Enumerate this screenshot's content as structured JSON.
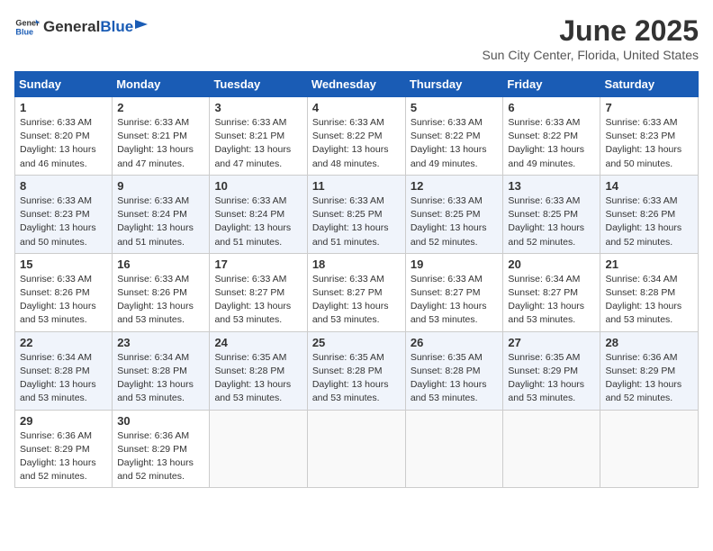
{
  "logo": {
    "general": "General",
    "blue": "Blue"
  },
  "title": "June 2025",
  "location": "Sun City Center, Florida, United States",
  "days": [
    "Sunday",
    "Monday",
    "Tuesday",
    "Wednesday",
    "Thursday",
    "Friday",
    "Saturday"
  ],
  "weeks": [
    [
      {
        "day": "1",
        "sunrise": "6:33 AM",
        "sunset": "8:20 PM",
        "daylight": "13 hours and 46 minutes."
      },
      {
        "day": "2",
        "sunrise": "6:33 AM",
        "sunset": "8:21 PM",
        "daylight": "13 hours and 47 minutes."
      },
      {
        "day": "3",
        "sunrise": "6:33 AM",
        "sunset": "8:21 PM",
        "daylight": "13 hours and 47 minutes."
      },
      {
        "day": "4",
        "sunrise": "6:33 AM",
        "sunset": "8:22 PM",
        "daylight": "13 hours and 48 minutes."
      },
      {
        "day": "5",
        "sunrise": "6:33 AM",
        "sunset": "8:22 PM",
        "daylight": "13 hours and 49 minutes."
      },
      {
        "day": "6",
        "sunrise": "6:33 AM",
        "sunset": "8:22 PM",
        "daylight": "13 hours and 49 minutes."
      },
      {
        "day": "7",
        "sunrise": "6:33 AM",
        "sunset": "8:23 PM",
        "daylight": "13 hours and 50 minutes."
      }
    ],
    [
      {
        "day": "8",
        "sunrise": "6:33 AM",
        "sunset": "8:23 PM",
        "daylight": "13 hours and 50 minutes."
      },
      {
        "day": "9",
        "sunrise": "6:33 AM",
        "sunset": "8:24 PM",
        "daylight": "13 hours and 51 minutes."
      },
      {
        "day": "10",
        "sunrise": "6:33 AM",
        "sunset": "8:24 PM",
        "daylight": "13 hours and 51 minutes."
      },
      {
        "day": "11",
        "sunrise": "6:33 AM",
        "sunset": "8:25 PM",
        "daylight": "13 hours and 51 minutes."
      },
      {
        "day": "12",
        "sunrise": "6:33 AM",
        "sunset": "8:25 PM",
        "daylight": "13 hours and 52 minutes."
      },
      {
        "day": "13",
        "sunrise": "6:33 AM",
        "sunset": "8:25 PM",
        "daylight": "13 hours and 52 minutes."
      },
      {
        "day": "14",
        "sunrise": "6:33 AM",
        "sunset": "8:26 PM",
        "daylight": "13 hours and 52 minutes."
      }
    ],
    [
      {
        "day": "15",
        "sunrise": "6:33 AM",
        "sunset": "8:26 PM",
        "daylight": "13 hours and 53 minutes."
      },
      {
        "day": "16",
        "sunrise": "6:33 AM",
        "sunset": "8:26 PM",
        "daylight": "13 hours and 53 minutes."
      },
      {
        "day": "17",
        "sunrise": "6:33 AM",
        "sunset": "8:27 PM",
        "daylight": "13 hours and 53 minutes."
      },
      {
        "day": "18",
        "sunrise": "6:33 AM",
        "sunset": "8:27 PM",
        "daylight": "13 hours and 53 minutes."
      },
      {
        "day": "19",
        "sunrise": "6:33 AM",
        "sunset": "8:27 PM",
        "daylight": "13 hours and 53 minutes."
      },
      {
        "day": "20",
        "sunrise": "6:34 AM",
        "sunset": "8:27 PM",
        "daylight": "13 hours and 53 minutes."
      },
      {
        "day": "21",
        "sunrise": "6:34 AM",
        "sunset": "8:28 PM",
        "daylight": "13 hours and 53 minutes."
      }
    ],
    [
      {
        "day": "22",
        "sunrise": "6:34 AM",
        "sunset": "8:28 PM",
        "daylight": "13 hours and 53 minutes."
      },
      {
        "day": "23",
        "sunrise": "6:34 AM",
        "sunset": "8:28 PM",
        "daylight": "13 hours and 53 minutes."
      },
      {
        "day": "24",
        "sunrise": "6:35 AM",
        "sunset": "8:28 PM",
        "daylight": "13 hours and 53 minutes."
      },
      {
        "day": "25",
        "sunrise": "6:35 AM",
        "sunset": "8:28 PM",
        "daylight": "13 hours and 53 minutes."
      },
      {
        "day": "26",
        "sunrise": "6:35 AM",
        "sunset": "8:28 PM",
        "daylight": "13 hours and 53 minutes."
      },
      {
        "day": "27",
        "sunrise": "6:35 AM",
        "sunset": "8:29 PM",
        "daylight": "13 hours and 53 minutes."
      },
      {
        "day": "28",
        "sunrise": "6:36 AM",
        "sunset": "8:29 PM",
        "daylight": "13 hours and 52 minutes."
      }
    ],
    [
      {
        "day": "29",
        "sunrise": "6:36 AM",
        "sunset": "8:29 PM",
        "daylight": "13 hours and 52 minutes."
      },
      {
        "day": "30",
        "sunrise": "6:36 AM",
        "sunset": "8:29 PM",
        "daylight": "13 hours and 52 minutes."
      },
      null,
      null,
      null,
      null,
      null
    ]
  ],
  "labels": {
    "sunrise": "Sunrise:",
    "sunset": "Sunset:",
    "daylight": "Daylight: "
  }
}
